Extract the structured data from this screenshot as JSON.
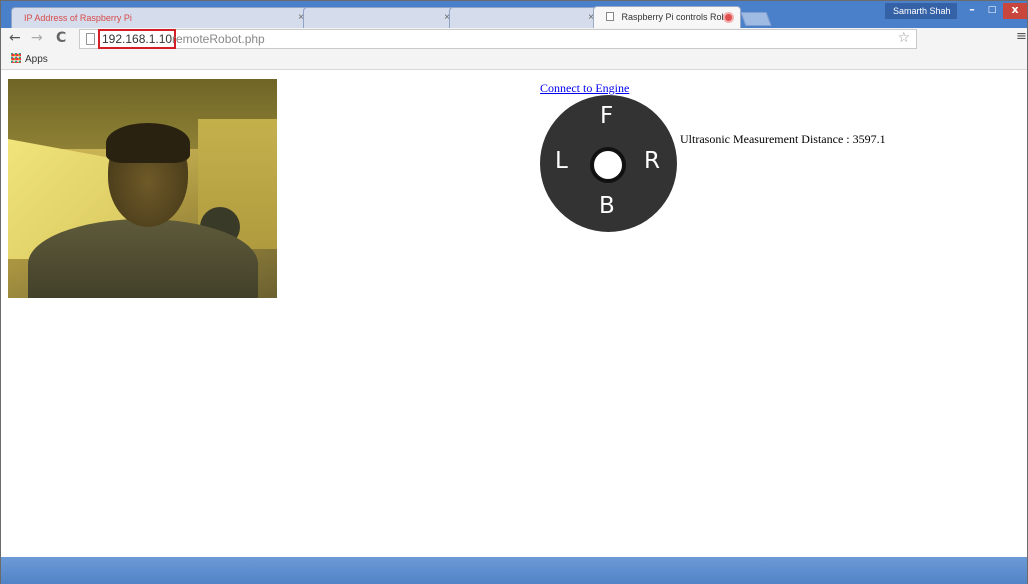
{
  "browser": {
    "tabs": [
      {
        "label": "IP Address of Raspberry Pi",
        "close": "×"
      },
      {
        "label": "",
        "close": "×"
      },
      {
        "label": "",
        "close": "×"
      },
      {
        "label": "Raspberry Pi controls Rob",
        "close": ""
      }
    ],
    "user": "Samarth Shah",
    "window_controls": {
      "minimize": "–",
      "maximize": "□",
      "close": "x"
    },
    "nav": {
      "back": "←",
      "forward": "→",
      "reload": "C"
    },
    "url": {
      "host": "192.168.1.10",
      "path": "remoteRobot.php"
    },
    "star": "☆",
    "menu": "≡",
    "bookmarks": {
      "apps": "Apps"
    }
  },
  "page": {
    "connect_link": "Connect to Engine",
    "joystick": {
      "forward": "F",
      "back": "B",
      "left": "L",
      "right": "R"
    },
    "measurement": "Ultrasonic Measurement Distance : 3597.1"
  },
  "colors": {
    "accent": "#4a7fc9",
    "url_highlight": "#d51f26",
    "joystick": "#333333",
    "link": "#0000ee"
  }
}
